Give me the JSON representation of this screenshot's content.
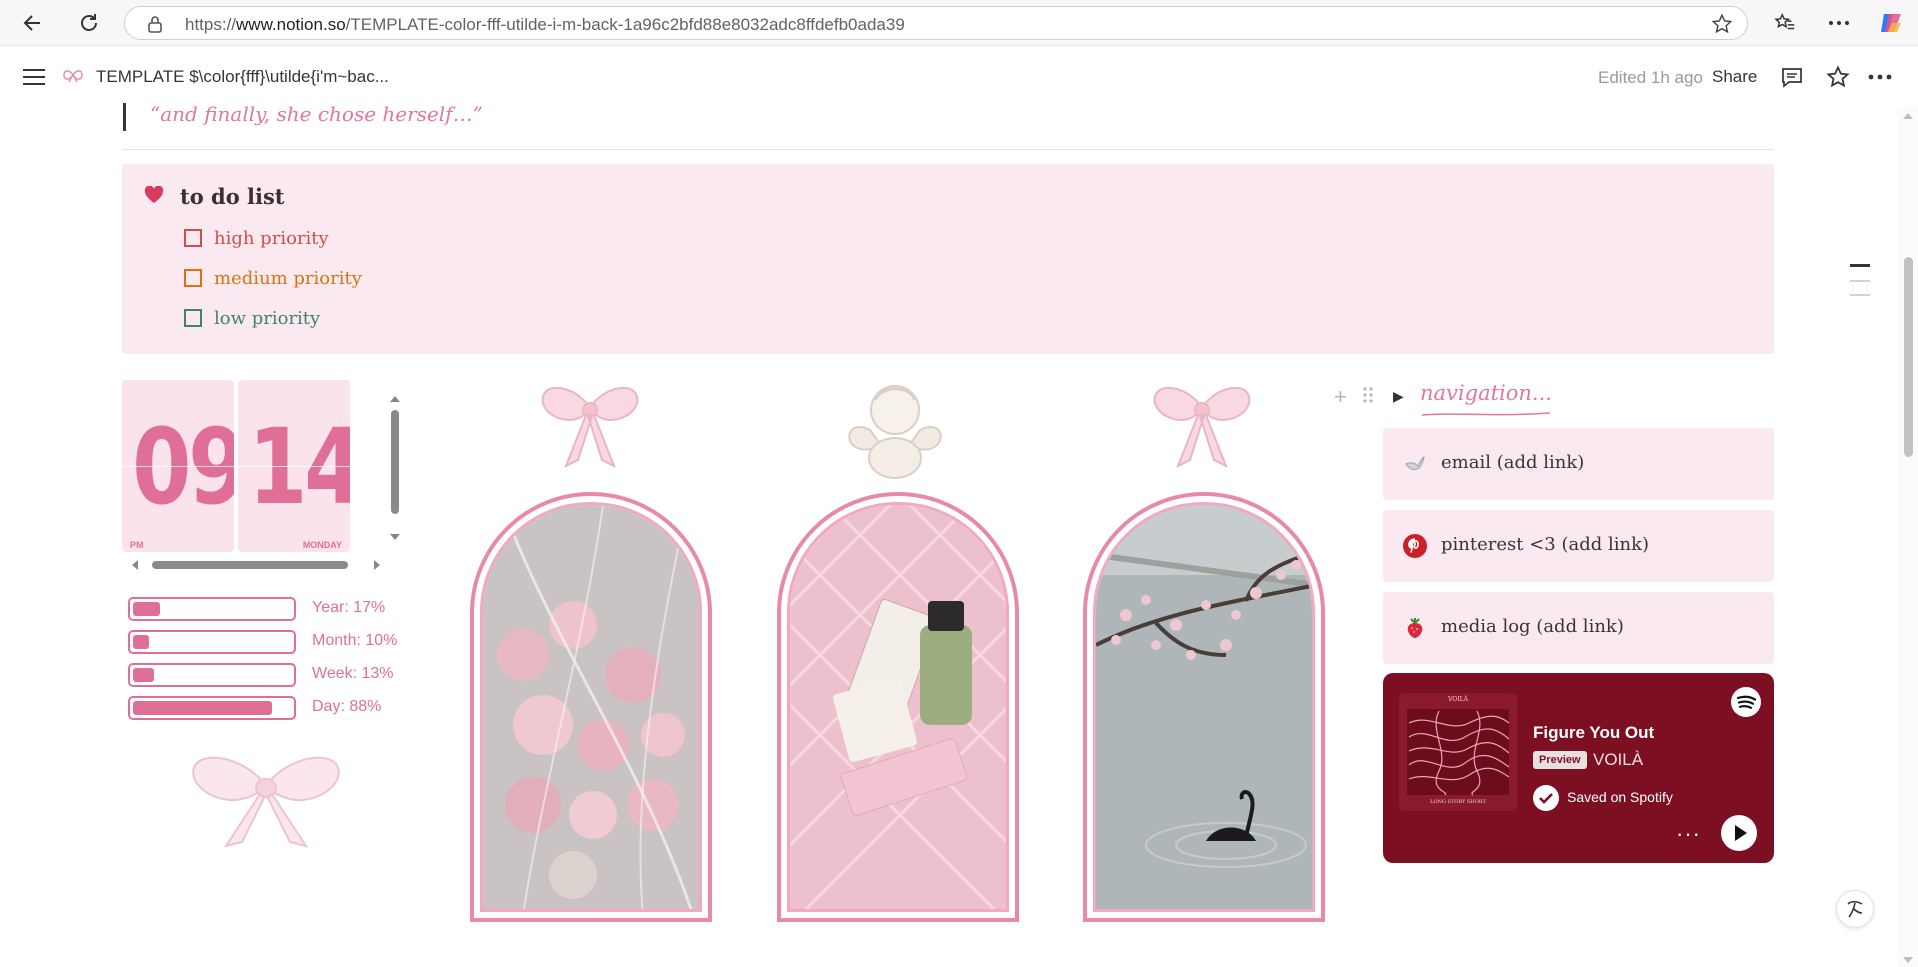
{
  "browser": {
    "url_prefix": "https://",
    "url_domain": "www.notion.so",
    "url_path": "/TEMPLATE-color-fff-utilde-i-m-back-1a96c2bfd88e8032adc8ffdefb0ada39"
  },
  "topbar": {
    "page_title": "TEMPLATE $\\color{fff}\\utilde{i'm~bac...",
    "edited": "Edited 1h ago",
    "share_label": "Share"
  },
  "quote": "“and finally, she chose herself…”",
  "todo": {
    "title": "to do list",
    "items": [
      {
        "label": "high priority",
        "color": "#d44c47"
      },
      {
        "label": "medium priority",
        "color": "#d9730d"
      },
      {
        "label": "low priority",
        "color": "#448361"
      }
    ]
  },
  "clock": {
    "hour": "09",
    "minute": "14",
    "period": "PM",
    "day": "MONDAY"
  },
  "progress": [
    {
      "label": "Year: 17%",
      "value": 17
    },
    {
      "label": "Month: 10%",
      "value": 10
    },
    {
      "label": "Week: 13%",
      "value": 13
    },
    {
      "label": "Day: 88%",
      "value": 88
    }
  ],
  "navigation": {
    "title": "navigation...",
    "links": [
      {
        "label": "email (add link)",
        "icon": "dove-icon"
      },
      {
        "label": "pinterest <3 (add link)",
        "icon": "pinterest-icon"
      },
      {
        "label": "media log (add link)",
        "icon": "strawberry-icon"
      }
    ]
  },
  "spotify": {
    "song": "Figure You Out",
    "badge": "Preview",
    "artist": "VOILÀ",
    "saved": "Saved on Spotify",
    "album_top": "VOILÀ",
    "album_bottom": "LONG STORY SHORT"
  },
  "colors": {
    "accent_pink": "#e0789c",
    "card_pink": "#fbe9f1",
    "spotify_bg": "#7d0f23"
  }
}
